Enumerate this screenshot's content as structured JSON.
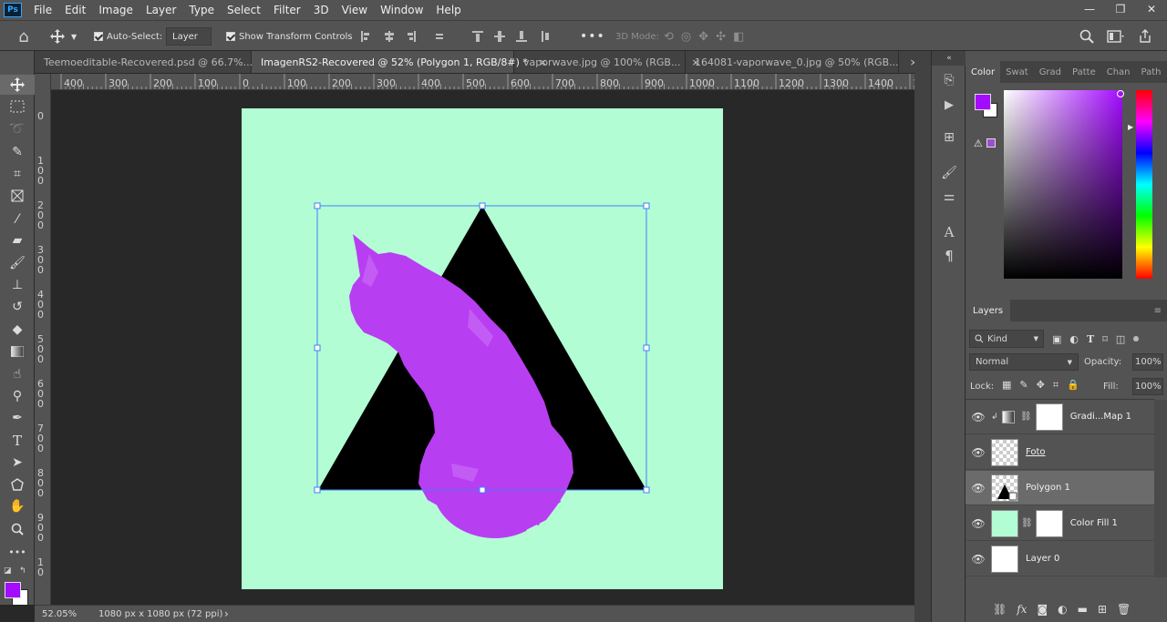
{
  "menu": {
    "logo": "Ps",
    "items": [
      "File",
      "Edit",
      "Image",
      "Layer",
      "Type",
      "Select",
      "Filter",
      "3D",
      "View",
      "Window",
      "Help"
    ]
  },
  "window_controls": {
    "minimize": "—",
    "restore": "❐",
    "close": "✕"
  },
  "options": {
    "auto_select_label": "Auto-Select:",
    "auto_select_target": "Layer",
    "show_transform_label": "Show Transform Controls",
    "more": "•••",
    "mode_3d_label": "3D Mode:"
  },
  "tabs": [
    {
      "label": "Teemoeditable-Recovered.psd @ 66.7%...",
      "close": "×"
    },
    {
      "label": "ImagenRS2-Recovered @ 52% (Polygon 1, RGB/8#) *",
      "close": "×"
    },
    {
      "label": "vaporwave.jpg @ 100% (RGB...",
      "close": "×"
    },
    {
      "label": "164081-vaporwave_0.jpg @ 50% (RGB...",
      "close": "×"
    }
  ],
  "ruler_top": [
    "400",
    "300",
    "200",
    "100",
    "0",
    "100",
    "200",
    "300",
    "400",
    "500",
    "600",
    "700",
    "800",
    "900",
    "1000",
    "1100",
    "1200",
    "1300",
    "1400",
    "1"
  ],
  "ruler_left": [
    [
      "0"
    ],
    [
      "1",
      "0",
      "0"
    ],
    [
      "2",
      "0",
      "0"
    ],
    [
      "3",
      "0",
      "0"
    ],
    [
      "4",
      "0",
      "0"
    ],
    [
      "5",
      "0",
      "0"
    ],
    [
      "6",
      "0",
      "0"
    ],
    [
      "7",
      "0",
      "0"
    ],
    [
      "8",
      "0",
      "0"
    ],
    [
      "9",
      "0",
      "0"
    ],
    [
      "1",
      "0"
    ]
  ],
  "status": {
    "zoom": "52.05%",
    "doc_size": "1080 px x 1080 px (72 ppi)",
    "arrow": "›"
  },
  "colors": {
    "foreground": "#a30cff",
    "background": "#ffffff",
    "canvas": "#b3fdd4",
    "cat": "#b83ef2",
    "triangle": "#000000",
    "selection": "#3d7fff"
  },
  "color_panel": {
    "tabs": [
      "Color",
      "Swat",
      "Grad",
      "Patte",
      "Chan",
      "Path"
    ]
  },
  "layers_panel": {
    "title": "Layers",
    "kind_label": "Kind",
    "blend_mode": "Normal",
    "opacity_label": "Opacity:",
    "opacity_value": "100%",
    "lock_label": "Lock:",
    "fill_label": "Fill:",
    "fill_value": "100%",
    "layers": [
      {
        "name": "Gradi...Map 1"
      },
      {
        "name": "Foto"
      },
      {
        "name": "Polygon 1"
      },
      {
        "name": "Color Fill 1"
      },
      {
        "name": "Layer 0"
      }
    ]
  }
}
